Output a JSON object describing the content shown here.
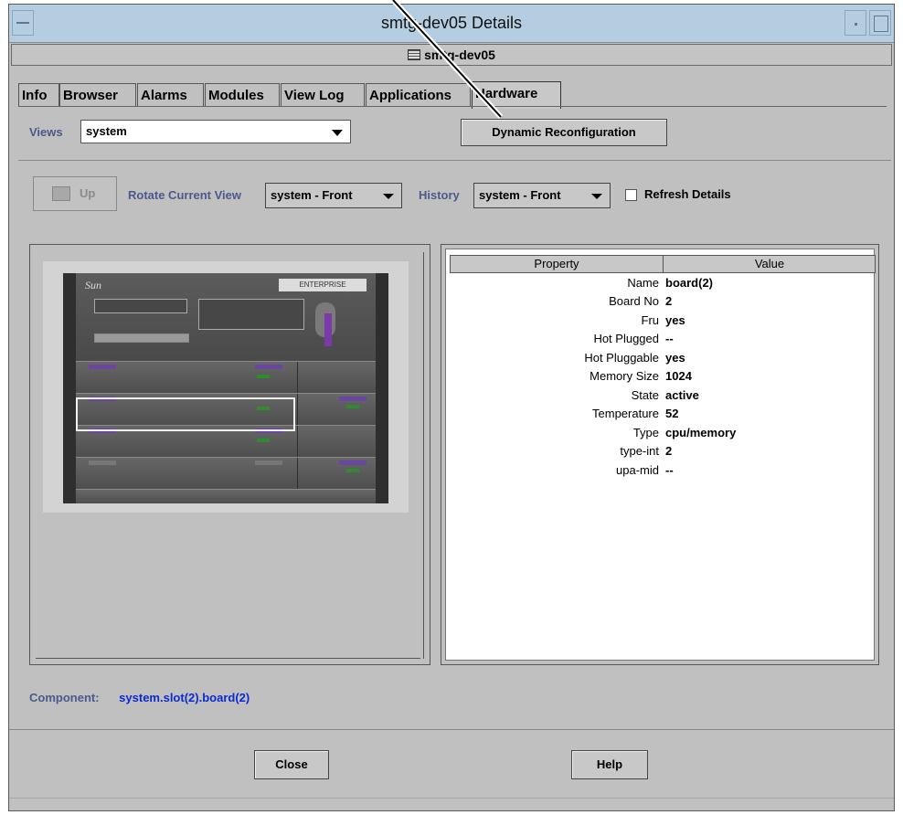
{
  "window": {
    "title": "smtg-dev05 Details",
    "host": "smtg-dev05"
  },
  "tabs": [
    {
      "label": "Info"
    },
    {
      "label": "Browser"
    },
    {
      "label": "Alarms"
    },
    {
      "label": "Modules"
    },
    {
      "label": "View Log"
    },
    {
      "label": "Applications"
    },
    {
      "label": "Hardware",
      "active": true
    }
  ],
  "views": {
    "label": "Views",
    "value": "system",
    "dynamic_reconfig_label": "Dynamic Reconfiguration"
  },
  "toolbar": {
    "up_label": "Up",
    "rotate_label": "Rotate Current View",
    "rotate_value": "system - Front",
    "history_label": "History",
    "history_value": "system - Front",
    "refresh_label": "Refresh Details",
    "refresh_checked": false
  },
  "chassis": {
    "brand": "Sun",
    "badge": "ENTERPRISE"
  },
  "properties": {
    "header_property": "Property",
    "header_value": "Value",
    "rows": [
      {
        "key": "Name",
        "value": "board(2)"
      },
      {
        "key": "Board No",
        "value": "2"
      },
      {
        "key": "Fru",
        "value": "yes"
      },
      {
        "key": "Hot Plugged",
        "value": "--"
      },
      {
        "key": "Hot Pluggable",
        "value": "yes"
      },
      {
        "key": "Memory Size",
        "value": "1024"
      },
      {
        "key": "State",
        "value": "active"
      },
      {
        "key": "Temperature",
        "value": "52"
      },
      {
        "key": "Type",
        "value": "cpu/memory"
      },
      {
        "key": "type-int",
        "value": "2"
      },
      {
        "key": "upa-mid",
        "value": "--"
      }
    ]
  },
  "component": {
    "label": "Component:",
    "value": "system.slot(2).board(2)"
  },
  "footer": {
    "close_label": "Close",
    "help_label": "Help"
  },
  "colors": {
    "titlebar": "#b4cde0",
    "window_bg": "#c0c0c0",
    "label_blue": "#4b5a8c",
    "component_blue": "#0a2bd1"
  }
}
